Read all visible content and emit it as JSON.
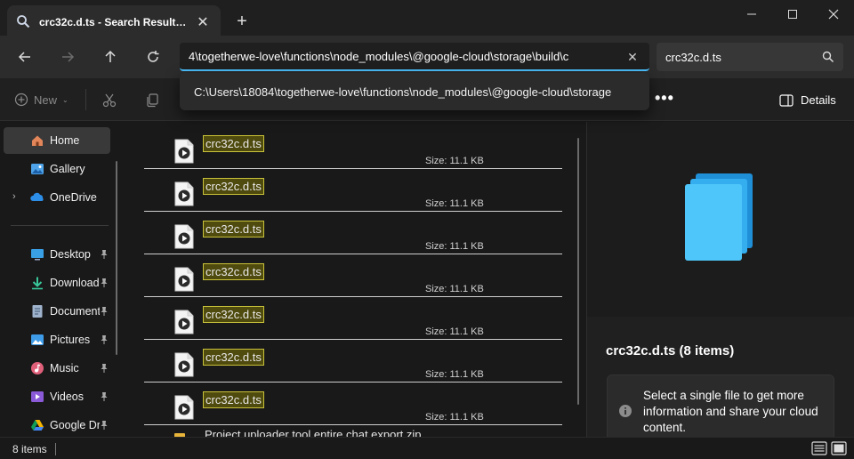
{
  "window": {
    "tab_title": "crc32c.d.ts - Search Results in ...",
    "new_tab": "+",
    "minimize": "—",
    "maximize": "☐",
    "close": "✕"
  },
  "address_bar": {
    "path_text": "4\\togetherwe-love\\functions\\node_modules\\@google-cloud\\storage\\build\\c",
    "suggestion": "C:\\Users\\18084\\togetherwe-love\\functions\\node_modules\\@google-cloud\\storage",
    "search_query": "crc32c.d.ts"
  },
  "toolbar": {
    "new_label": "New",
    "more_label": "•••",
    "details_label": "Details"
  },
  "sidebar": {
    "items": [
      {
        "label": "Home",
        "icon": "home-icon"
      },
      {
        "label": "Gallery",
        "icon": "gallery-icon"
      },
      {
        "label": "OneDrive - P",
        "icon": "onedrive-icon"
      },
      {
        "label": "Desktop",
        "icon": "desktop-icon"
      },
      {
        "label": "Downloads",
        "icon": "downloads-icon"
      },
      {
        "label": "Documents",
        "icon": "documents-icon"
      },
      {
        "label": "Pictures",
        "icon": "pictures-icon"
      },
      {
        "label": "Music",
        "icon": "music-icon"
      },
      {
        "label": "Videos",
        "icon": "videos-icon"
      },
      {
        "label": "Google Drive",
        "icon": "google-drive-icon"
      }
    ]
  },
  "results": {
    "files": [
      {
        "name": "crc32c.d.ts",
        "size": "Size: 11.1 KB"
      },
      {
        "name": "crc32c.d.ts",
        "size": "Size: 11.1 KB"
      },
      {
        "name": "crc32c.d.ts",
        "size": "Size: 11.1 KB"
      },
      {
        "name": "crc32c.d.ts",
        "size": "Size: 11.1 KB"
      },
      {
        "name": "crc32c.d.ts",
        "size": "Size: 11.1 KB"
      },
      {
        "name": "crc32c.d.ts",
        "size": "Size: 11.1 KB"
      },
      {
        "name": "crc32c.d.ts",
        "size": "Size: 11.1 KB"
      }
    ],
    "partial_item": "Project uploader tool entire chat export.zip"
  },
  "details_pane": {
    "title": "crc32c.d.ts (8 items)",
    "info": "Select a single file to get more information and share your cloud content."
  },
  "status": {
    "count": "8 items"
  },
  "colors": {
    "accent": "#4cc2ff",
    "highlight_fill": "#4f4a0e",
    "highlight_border": "#c9c23a"
  }
}
